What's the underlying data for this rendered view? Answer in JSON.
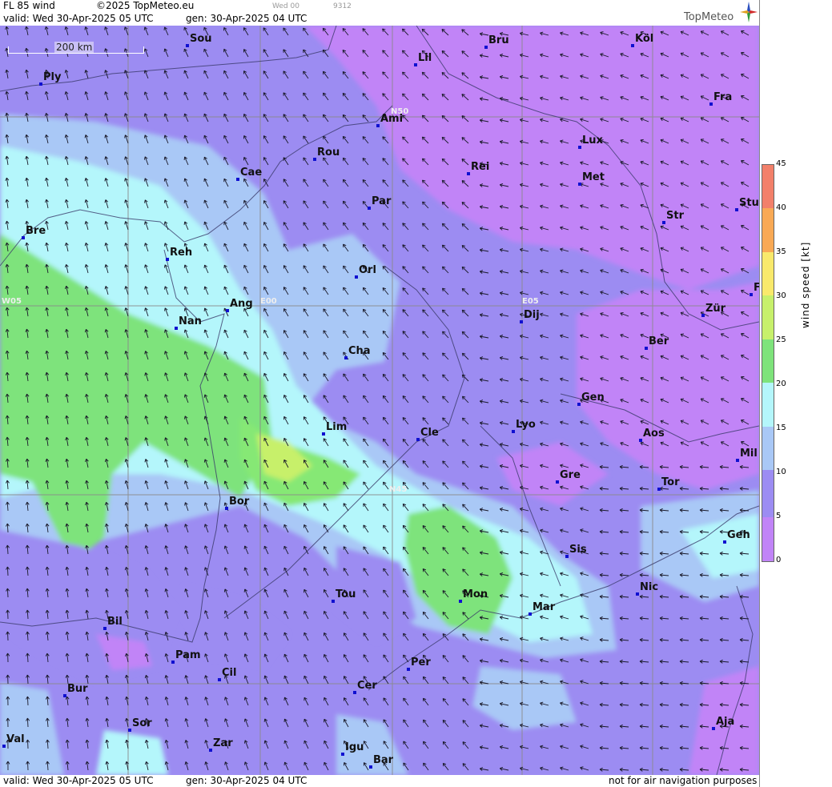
{
  "header": {
    "product": "FL 85 wind",
    "copyright": "©2025 TopMeteo.eu",
    "run": "Wed 00",
    "code": "9312",
    "valid": "valid:  Wed  30-Apr-2025  05 UTC",
    "gen": "gen:  30-Apr-2025  04 UTC",
    "logo": "TopMeteo"
  },
  "footer": {
    "valid": "valid:  Wed  30-Apr-2025  05 UTC",
    "gen": "gen:  30-Apr-2025  04 UTC",
    "disclaimer": "not for air navigation purposes"
  },
  "scale_bar": "200 km",
  "colorbar": {
    "label": "wind  speed  [kt]",
    "ticks": [
      "45",
      "40",
      "35",
      "30",
      "25",
      "20",
      "15",
      "10",
      "5",
      "0"
    ]
  },
  "grid_labels": [
    "N50",
    "N45",
    "W05",
    "E00",
    "E05"
  ],
  "cities": [
    {
      "name": "Sou"
    },
    {
      "name": "Bru"
    },
    {
      "name": "Köl"
    },
    {
      "name": "Lil"
    },
    {
      "name": "Ply"
    },
    {
      "name": "Ami"
    },
    {
      "name": "Fra"
    },
    {
      "name": "Rou"
    },
    {
      "name": "Lux"
    },
    {
      "name": "Cae"
    },
    {
      "name": "Rei"
    },
    {
      "name": "Met"
    },
    {
      "name": "Par"
    },
    {
      "name": "Str"
    },
    {
      "name": "Stu"
    },
    {
      "name": "Bre"
    },
    {
      "name": "Reh"
    },
    {
      "name": "Orl"
    },
    {
      "name": "Ang"
    },
    {
      "name": "Dij"
    },
    {
      "name": "Zür"
    },
    {
      "name": "Nan"
    },
    {
      "name": "Cha"
    },
    {
      "name": "Ber"
    },
    {
      "name": "Gen"
    },
    {
      "name": "Lim"
    },
    {
      "name": "Cle"
    },
    {
      "name": "Lyo"
    },
    {
      "name": "Aos"
    },
    {
      "name": "Mil"
    },
    {
      "name": "Gre"
    },
    {
      "name": "Tor"
    },
    {
      "name": "Bor"
    },
    {
      "name": "Sis"
    },
    {
      "name": "Geh"
    },
    {
      "name": "Nic"
    },
    {
      "name": "Tou"
    },
    {
      "name": "Mon"
    },
    {
      "name": "Mar"
    },
    {
      "name": "Bil"
    },
    {
      "name": "Pam"
    },
    {
      "name": "Cil"
    },
    {
      "name": "Per"
    },
    {
      "name": "Cer"
    },
    {
      "name": "Bur"
    },
    {
      "name": "Sor"
    },
    {
      "name": "Aja"
    },
    {
      "name": "Val"
    },
    {
      "name": "Zar"
    },
    {
      "name": "Igu"
    },
    {
      "name": "Bar"
    },
    {
      "name": "F"
    }
  ]
}
